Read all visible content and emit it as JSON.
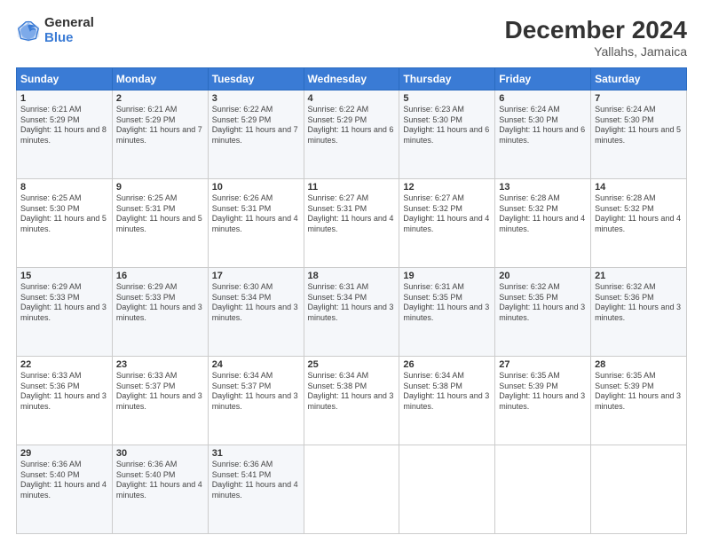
{
  "logo": {
    "general": "General",
    "blue": "Blue"
  },
  "title": {
    "month": "December 2024",
    "location": "Yallahs, Jamaica"
  },
  "headers": [
    "Sunday",
    "Monday",
    "Tuesday",
    "Wednesday",
    "Thursday",
    "Friday",
    "Saturday"
  ],
  "weeks": [
    [
      {
        "day": "1",
        "sunrise": "6:21 AM",
        "sunset": "5:29 PM",
        "daylight": "11 hours and 8 minutes."
      },
      {
        "day": "2",
        "sunrise": "6:21 AM",
        "sunset": "5:29 PM",
        "daylight": "11 hours and 7 minutes."
      },
      {
        "day": "3",
        "sunrise": "6:22 AM",
        "sunset": "5:29 PM",
        "daylight": "11 hours and 7 minutes."
      },
      {
        "day": "4",
        "sunrise": "6:22 AM",
        "sunset": "5:29 PM",
        "daylight": "11 hours and 6 minutes."
      },
      {
        "day": "5",
        "sunrise": "6:23 AM",
        "sunset": "5:30 PM",
        "daylight": "11 hours and 6 minutes."
      },
      {
        "day": "6",
        "sunrise": "6:24 AM",
        "sunset": "5:30 PM",
        "daylight": "11 hours and 6 minutes."
      },
      {
        "day": "7",
        "sunrise": "6:24 AM",
        "sunset": "5:30 PM",
        "daylight": "11 hours and 5 minutes."
      }
    ],
    [
      {
        "day": "8",
        "sunrise": "6:25 AM",
        "sunset": "5:30 PM",
        "daylight": "11 hours and 5 minutes."
      },
      {
        "day": "9",
        "sunrise": "6:25 AM",
        "sunset": "5:31 PM",
        "daylight": "11 hours and 5 minutes."
      },
      {
        "day": "10",
        "sunrise": "6:26 AM",
        "sunset": "5:31 PM",
        "daylight": "11 hours and 4 minutes."
      },
      {
        "day": "11",
        "sunrise": "6:27 AM",
        "sunset": "5:31 PM",
        "daylight": "11 hours and 4 minutes."
      },
      {
        "day": "12",
        "sunrise": "6:27 AM",
        "sunset": "5:32 PM",
        "daylight": "11 hours and 4 minutes."
      },
      {
        "day": "13",
        "sunrise": "6:28 AM",
        "sunset": "5:32 PM",
        "daylight": "11 hours and 4 minutes."
      },
      {
        "day": "14",
        "sunrise": "6:28 AM",
        "sunset": "5:32 PM",
        "daylight": "11 hours and 4 minutes."
      }
    ],
    [
      {
        "day": "15",
        "sunrise": "6:29 AM",
        "sunset": "5:33 PM",
        "daylight": "11 hours and 3 minutes."
      },
      {
        "day": "16",
        "sunrise": "6:29 AM",
        "sunset": "5:33 PM",
        "daylight": "11 hours and 3 minutes."
      },
      {
        "day": "17",
        "sunrise": "6:30 AM",
        "sunset": "5:34 PM",
        "daylight": "11 hours and 3 minutes."
      },
      {
        "day": "18",
        "sunrise": "6:31 AM",
        "sunset": "5:34 PM",
        "daylight": "11 hours and 3 minutes."
      },
      {
        "day": "19",
        "sunrise": "6:31 AM",
        "sunset": "5:35 PM",
        "daylight": "11 hours and 3 minutes."
      },
      {
        "day": "20",
        "sunrise": "6:32 AM",
        "sunset": "5:35 PM",
        "daylight": "11 hours and 3 minutes."
      },
      {
        "day": "21",
        "sunrise": "6:32 AM",
        "sunset": "5:36 PM",
        "daylight": "11 hours and 3 minutes."
      }
    ],
    [
      {
        "day": "22",
        "sunrise": "6:33 AM",
        "sunset": "5:36 PM",
        "daylight": "11 hours and 3 minutes."
      },
      {
        "day": "23",
        "sunrise": "6:33 AM",
        "sunset": "5:37 PM",
        "daylight": "11 hours and 3 minutes."
      },
      {
        "day": "24",
        "sunrise": "6:34 AM",
        "sunset": "5:37 PM",
        "daylight": "11 hours and 3 minutes."
      },
      {
        "day": "25",
        "sunrise": "6:34 AM",
        "sunset": "5:38 PM",
        "daylight": "11 hours and 3 minutes."
      },
      {
        "day": "26",
        "sunrise": "6:34 AM",
        "sunset": "5:38 PM",
        "daylight": "11 hours and 3 minutes."
      },
      {
        "day": "27",
        "sunrise": "6:35 AM",
        "sunset": "5:39 PM",
        "daylight": "11 hours and 3 minutes."
      },
      {
        "day": "28",
        "sunrise": "6:35 AM",
        "sunset": "5:39 PM",
        "daylight": "11 hours and 3 minutes."
      }
    ],
    [
      {
        "day": "29",
        "sunrise": "6:36 AM",
        "sunset": "5:40 PM",
        "daylight": "11 hours and 4 minutes."
      },
      {
        "day": "30",
        "sunrise": "6:36 AM",
        "sunset": "5:40 PM",
        "daylight": "11 hours and 4 minutes."
      },
      {
        "day": "31",
        "sunrise": "6:36 AM",
        "sunset": "5:41 PM",
        "daylight": "11 hours and 4 minutes."
      },
      null,
      null,
      null,
      null
    ]
  ]
}
